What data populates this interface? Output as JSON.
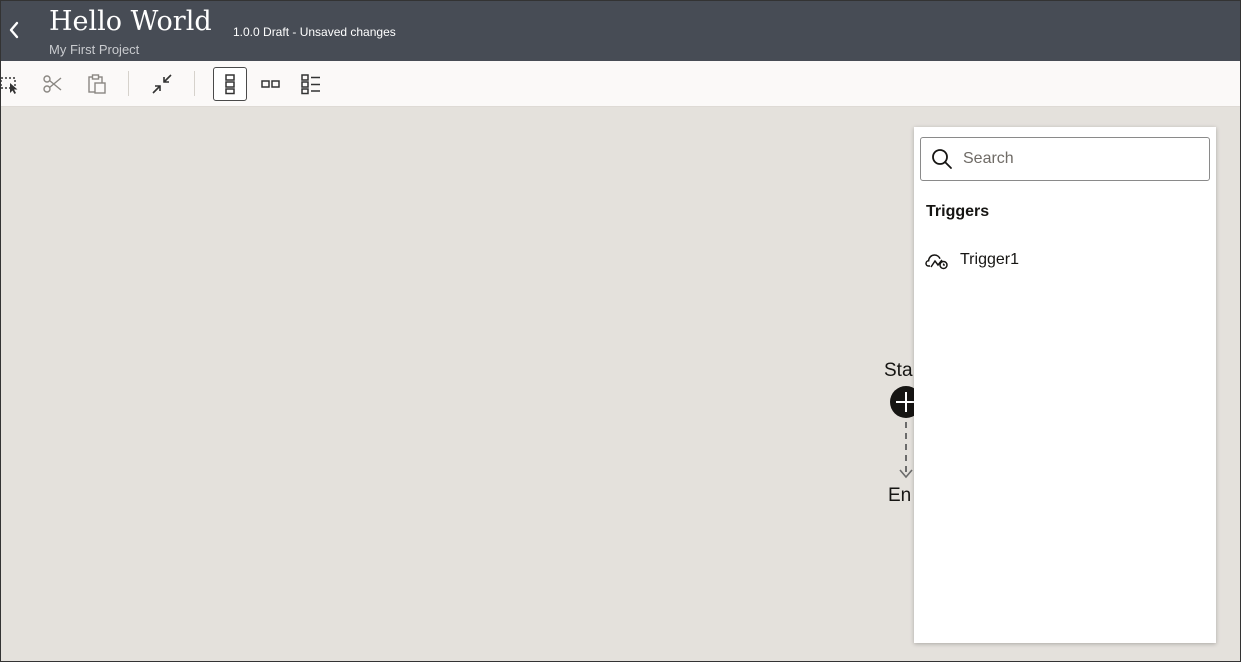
{
  "header": {
    "title": "Hello World",
    "subtitle": "My First Project",
    "status": "1.0.0 Draft - Unsaved changes",
    "back_icon": "chevron-left-icon"
  },
  "toolbar": {
    "buttons": [
      {
        "name": "select-tool",
        "icon": "marquee-select-icon"
      },
      {
        "name": "cut",
        "icon": "scissors-icon"
      },
      {
        "name": "paste",
        "icon": "clipboard-icon"
      },
      {
        "name": "collapse",
        "icon": "collapse-icon"
      },
      {
        "name": "vertical-layout",
        "icon": "vertical-layout-icon",
        "active": true
      },
      {
        "name": "horizontal-layout",
        "icon": "horizontal-layout-icon"
      },
      {
        "name": "list-layout",
        "icon": "list-layout-icon"
      }
    ]
  },
  "canvas": {
    "start_label": "Sta",
    "end_label": "En"
  },
  "panel": {
    "search_placeholder": "Search",
    "section_heading": "Triggers",
    "items": [
      {
        "label": "Trigger1",
        "icon": "cloud-trigger-icon"
      }
    ]
  },
  "colors": {
    "header_bg": "#474c55",
    "toolbar_bg": "#fbf9f8",
    "canvas_bg": "#e4e1dc",
    "panel_bg": "#ffffff",
    "text": "#161513"
  }
}
